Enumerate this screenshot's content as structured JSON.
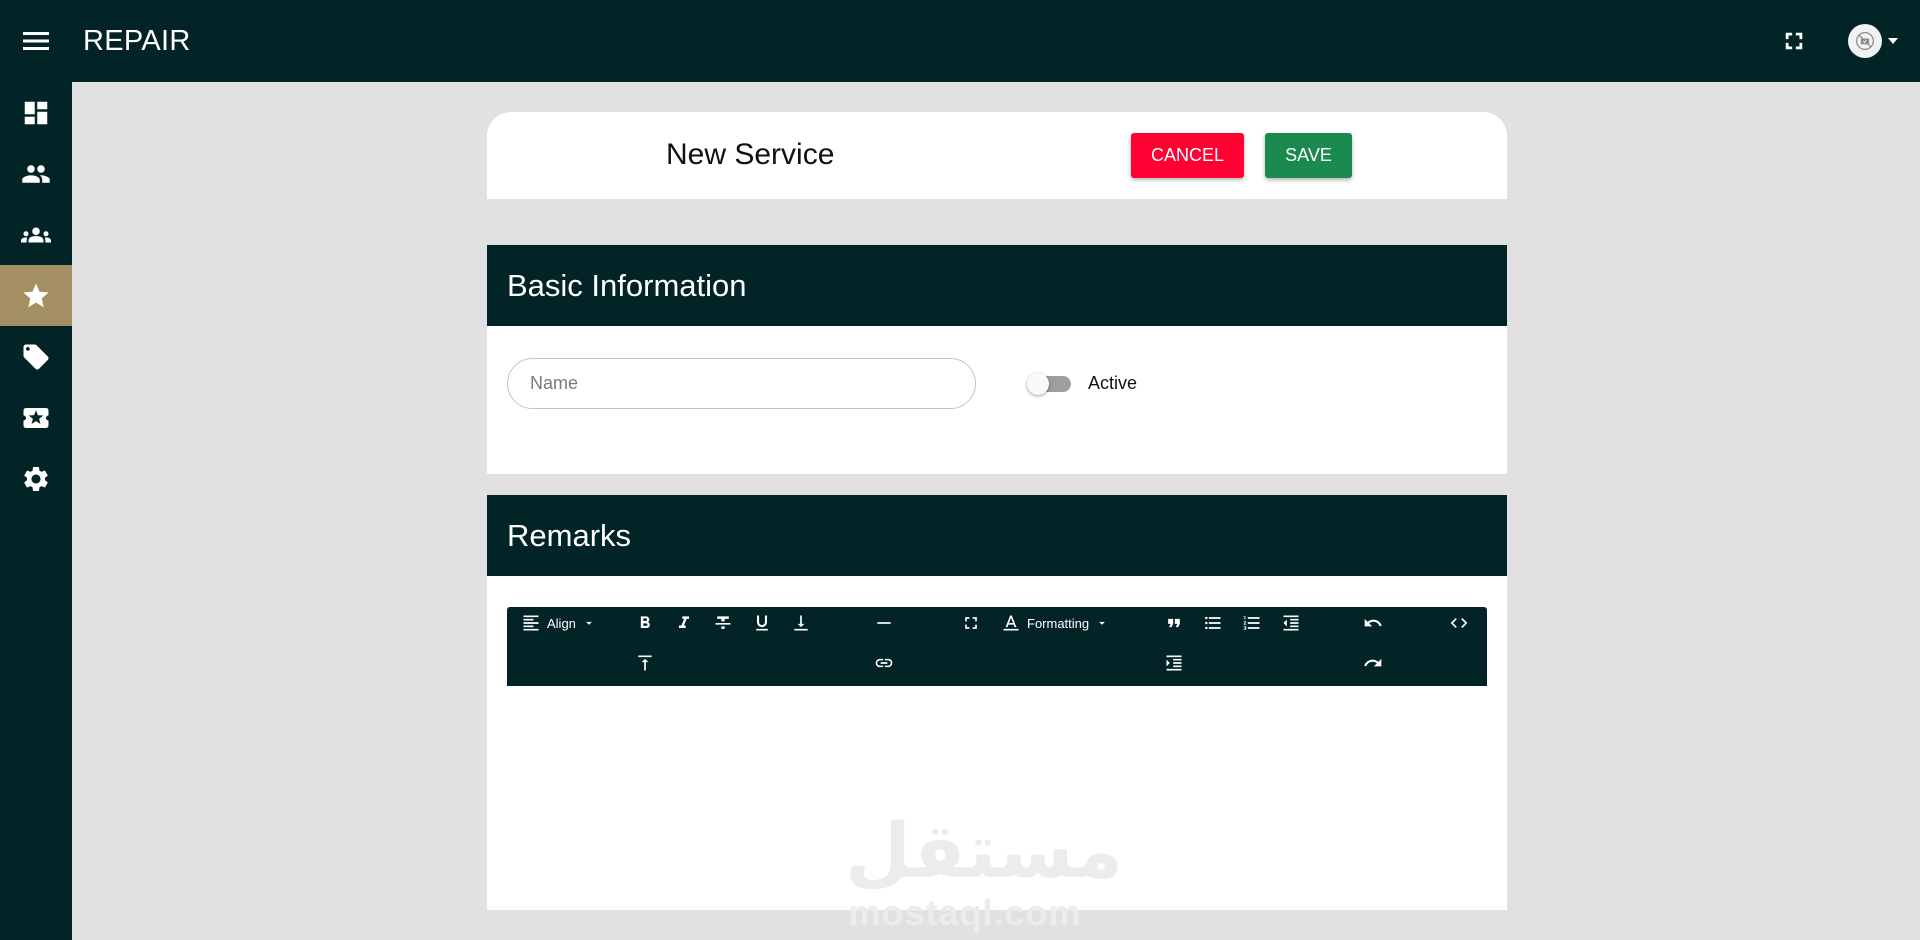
{
  "app": {
    "title": "REPAIR"
  },
  "header": {
    "title": "New Service",
    "cancel_label": "CANCEL",
    "save_label": "SAVE"
  },
  "sidebar": {
    "items": [
      {
        "icon": "dashboard-icon",
        "active": false
      },
      {
        "icon": "people-icon",
        "active": false
      },
      {
        "icon": "groups-icon",
        "active": false
      },
      {
        "icon": "star-icon",
        "active": true
      },
      {
        "icon": "tag-icon",
        "active": false
      },
      {
        "icon": "ticket-star-icon",
        "active": false
      },
      {
        "icon": "gear-icon",
        "active": false
      }
    ]
  },
  "basic_info": {
    "heading": "Basic Information",
    "name_placeholder": "Name",
    "name_value": "",
    "active_label": "Active",
    "active": false
  },
  "remarks": {
    "heading": "Remarks",
    "toolbar": {
      "align_label": "Align",
      "formatting_label": "Formatting"
    }
  },
  "watermark": {
    "arabic": "مستقل",
    "latin": "mostaql.com"
  },
  "colors": {
    "topbar": "#022427",
    "sidebar_active": "#a38f62",
    "cancel": "#ff0033",
    "save": "#1a8a4e",
    "background": "#e1e1e1"
  }
}
